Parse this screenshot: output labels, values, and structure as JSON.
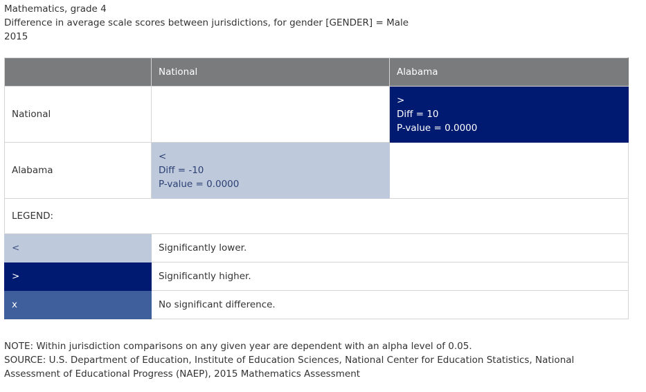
{
  "header": {
    "subject": "Mathematics, grade 4",
    "description": "Difference in average scale scores between jurisdictions, for gender [GENDER] = Male",
    "year": "2015"
  },
  "table": {
    "columns": [
      "",
      "National",
      "Alabama"
    ],
    "rows": [
      {
        "label": "National",
        "cells": [
          null,
          {
            "symbol": ">",
            "diff": "Diff = 10",
            "pvalue": "P-value = 0.0000"
          }
        ]
      },
      {
        "label": "Alabama",
        "cells": [
          {
            "symbol": "<",
            "diff": "Diff = -10",
            "pvalue": "P-value = 0.0000"
          },
          null
        ]
      }
    ]
  },
  "legend": {
    "title": "LEGEND:",
    "items": [
      {
        "symbol": "<",
        "text": "Significantly lower."
      },
      {
        "symbol": ">",
        "text": "Significantly higher."
      },
      {
        "symbol": "x",
        "text": "No significant difference."
      }
    ]
  },
  "colors": {
    "header_bg": "#7a7b7d",
    "higher": "#001a72",
    "lower": "#bec9dc",
    "no_difference": "#3e5f9c"
  },
  "footer": {
    "note": "NOTE: Within jurisdiction comparisons on any given year are dependent with an alpha level of 0.05.",
    "source": "SOURCE: U.S. Department of Education, Institute of Education Sciences, National Center for Education Statistics, National Assessment of Educational Progress (NAEP), 2015 Mathematics Assessment"
  }
}
